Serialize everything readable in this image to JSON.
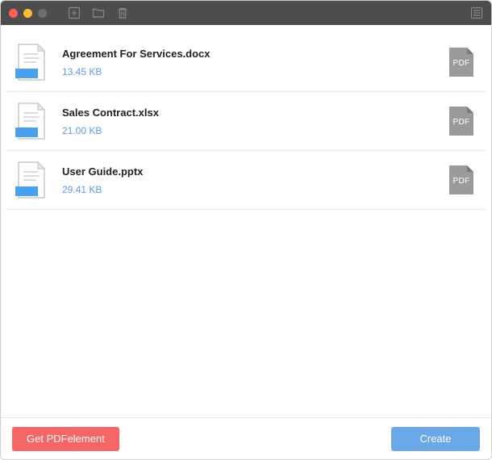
{
  "files": [
    {
      "name": "Agreement For Services.docx",
      "size": "13.45 KB"
    },
    {
      "name": "Sales Contract.xlsx",
      "size": "21.00 KB"
    },
    {
      "name": "User Guide.pptx",
      "size": "29.41 KB"
    }
  ],
  "pdf_label": "PDF",
  "footer": {
    "get_label": "Get PDFelement",
    "create_label": "Create"
  }
}
